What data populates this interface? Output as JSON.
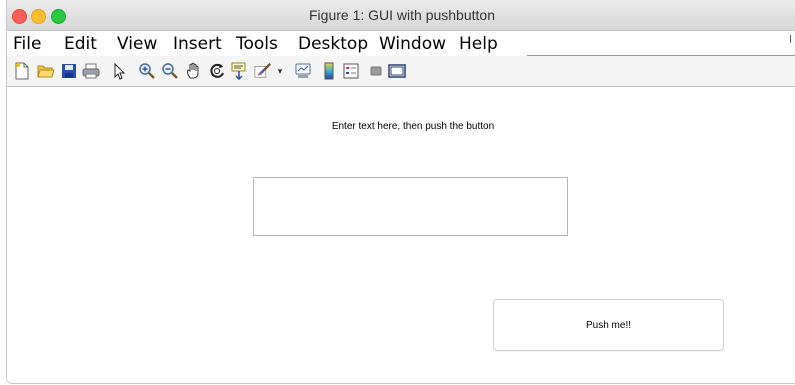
{
  "window": {
    "title": "Figure 1: GUI with pushbutton",
    "traffic_lights": {
      "close": "#fc5f57",
      "minimize": "#fdbd2e",
      "maximize": "#27c940"
    }
  },
  "menubar": {
    "items": [
      "File",
      "Edit",
      "View",
      "Insert",
      "Tools",
      "Desktop",
      "Window",
      "Help"
    ]
  },
  "toolbar": {
    "icons": [
      "new-figure-icon",
      "open-file-icon",
      "save-icon",
      "print-icon",
      "edit-plot-arrow-icon",
      "zoom-in-icon",
      "zoom-out-icon",
      "pan-hand-icon",
      "rotate-3d-icon",
      "data-cursor-icon",
      "brush-icon",
      "brush-dropdown-icon",
      "link-plot-icon",
      "insert-colorbar-icon",
      "insert-legend-icon",
      "hide-plot-tools-icon",
      "show-plot-tools-icon"
    ]
  },
  "content": {
    "prompt": "Enter text here, then push the button",
    "edit_value": "",
    "button_label": "Push me!!"
  }
}
